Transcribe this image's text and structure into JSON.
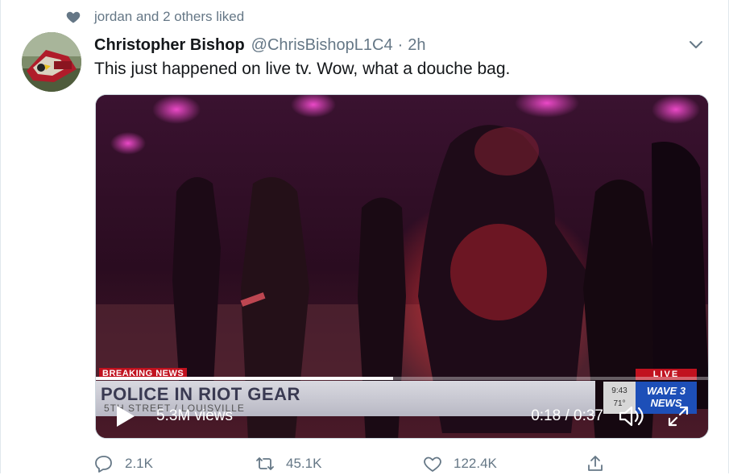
{
  "social_context": {
    "text": "jordan and 2 others liked",
    "icon": "heart-icon"
  },
  "tweet": {
    "display_name": "Christopher Bishop",
    "handle": "@ChrisBishopL1C4",
    "separator": "·",
    "time": "2h",
    "text": "This just happened on live tv. Wow, what a douche bag."
  },
  "video": {
    "breaking_label": "BREAKING NEWS",
    "headline": "POLICE IN RIOT GEAR",
    "subline": "5TH STREET / LOUISVILLE",
    "live_label": "LIVE",
    "clock_time": "9:43",
    "temperature": "71°",
    "station_logo": "WAVE 3 NEWS",
    "views": "5.3M views",
    "timecode": "0:18 / 0:37",
    "progress": 0.486
  },
  "actions": {
    "reply_count": "2.1K",
    "retweet_count": "45.1K",
    "like_count": "122.4K"
  },
  "colors": {
    "text_secondary": "#657786",
    "breaking_red": "#c1121f",
    "station_blue": "#1d4fb8"
  }
}
